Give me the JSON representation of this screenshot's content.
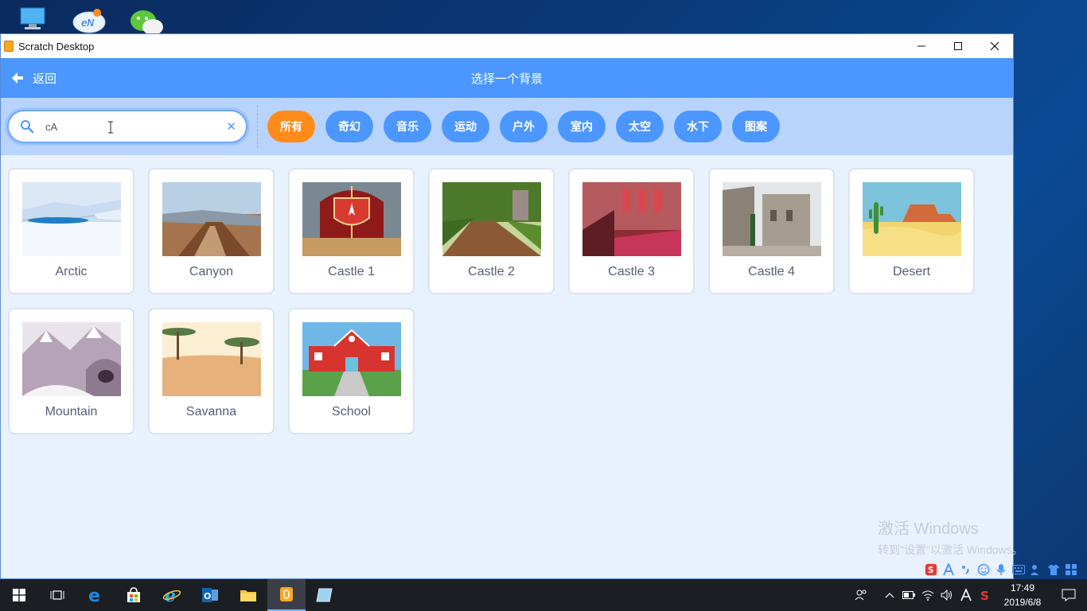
{
  "window": {
    "title": "Scratch Desktop"
  },
  "header": {
    "back_label": "返回",
    "title": "选择一个背景"
  },
  "search": {
    "value": "cA"
  },
  "tags": [
    "所有",
    "奇幻",
    "音乐",
    "运动",
    "户外",
    "室内",
    "太空",
    "水下",
    "图案"
  ],
  "active_tag": "所有",
  "backdrops": [
    {
      "name": "Arctic"
    },
    {
      "name": "Canyon"
    },
    {
      "name": "Castle 1"
    },
    {
      "name": "Castle 2"
    },
    {
      "name": "Castle 3"
    },
    {
      "name": "Castle 4"
    },
    {
      "name": "Desert"
    },
    {
      "name": "Mountain"
    },
    {
      "name": "Savanna"
    },
    {
      "name": "School"
    }
  ],
  "watermark": {
    "line1": "激活 Windows",
    "line2": "转到\"设置\"以激活 Windows。"
  },
  "clock": {
    "time": "17:49",
    "date": "2019/6/8"
  },
  "colors": {
    "header": "#4c97ff",
    "tag": "#4c97ff",
    "tag_active": "#ff8c1a",
    "filterbar": "#b8d4fd"
  }
}
